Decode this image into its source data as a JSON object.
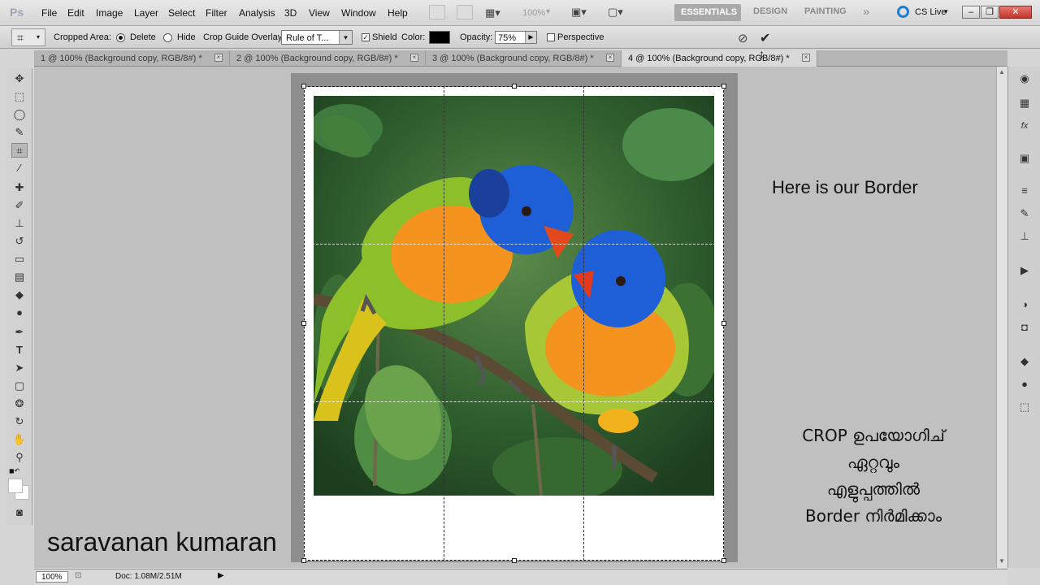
{
  "menubar": {
    "logo": "Ps",
    "items": [
      "File",
      "Edit",
      "Image",
      "Layer",
      "Select",
      "Filter",
      "Analysis",
      "3D",
      "View",
      "Window",
      "Help"
    ],
    "zoom_dropdown": "100%",
    "workspaces": [
      "ESSENTIALS",
      "DESIGN",
      "PAINTING"
    ],
    "more": "»",
    "cs_live": "CS Live"
  },
  "options": {
    "cropped_area_label": "Cropped Area:",
    "delete_label": "Delete",
    "hide_label": "Hide",
    "overlay_label": "Crop Guide Overlay:",
    "overlay_value": "Rule of T...",
    "shield_label": "Shield",
    "color_label": "Color:",
    "color_value": "#000000",
    "opacity_label": "Opacity:",
    "opacity_value": "75%",
    "perspective_label": "Perspective"
  },
  "tabs": [
    {
      "label": "1 @ 100% (Background copy, RGB/8#) *"
    },
    {
      "label": "2 @ 100% (Background copy, RGB/8#) *"
    },
    {
      "label": "3 @ 100% (Background copy, RGB/8#) *"
    },
    {
      "label": "4 @ 100% (Background copy, RGB/8#) *"
    }
  ],
  "captions": {
    "border_note": "Here is our Border",
    "malayalam_line1": "CROP ഉപയോഗിച്",
    "malayalam_line2": "ഏറ്റവും",
    "malayalam_line3": "എളുപ്പത്തിൽ",
    "malayalam_line4": "Border നിർമിക്കാം",
    "author": "saravanan kumaran"
  },
  "status": {
    "zoom": "100%",
    "doc": "Doc: 1.08M/2.51M"
  },
  "colors": {
    "accent_active_ws": "#a9a9a9",
    "bird_blue": "#1e5fd8",
    "bird_orange": "#f4931e",
    "foliage": "#3b6b35"
  }
}
